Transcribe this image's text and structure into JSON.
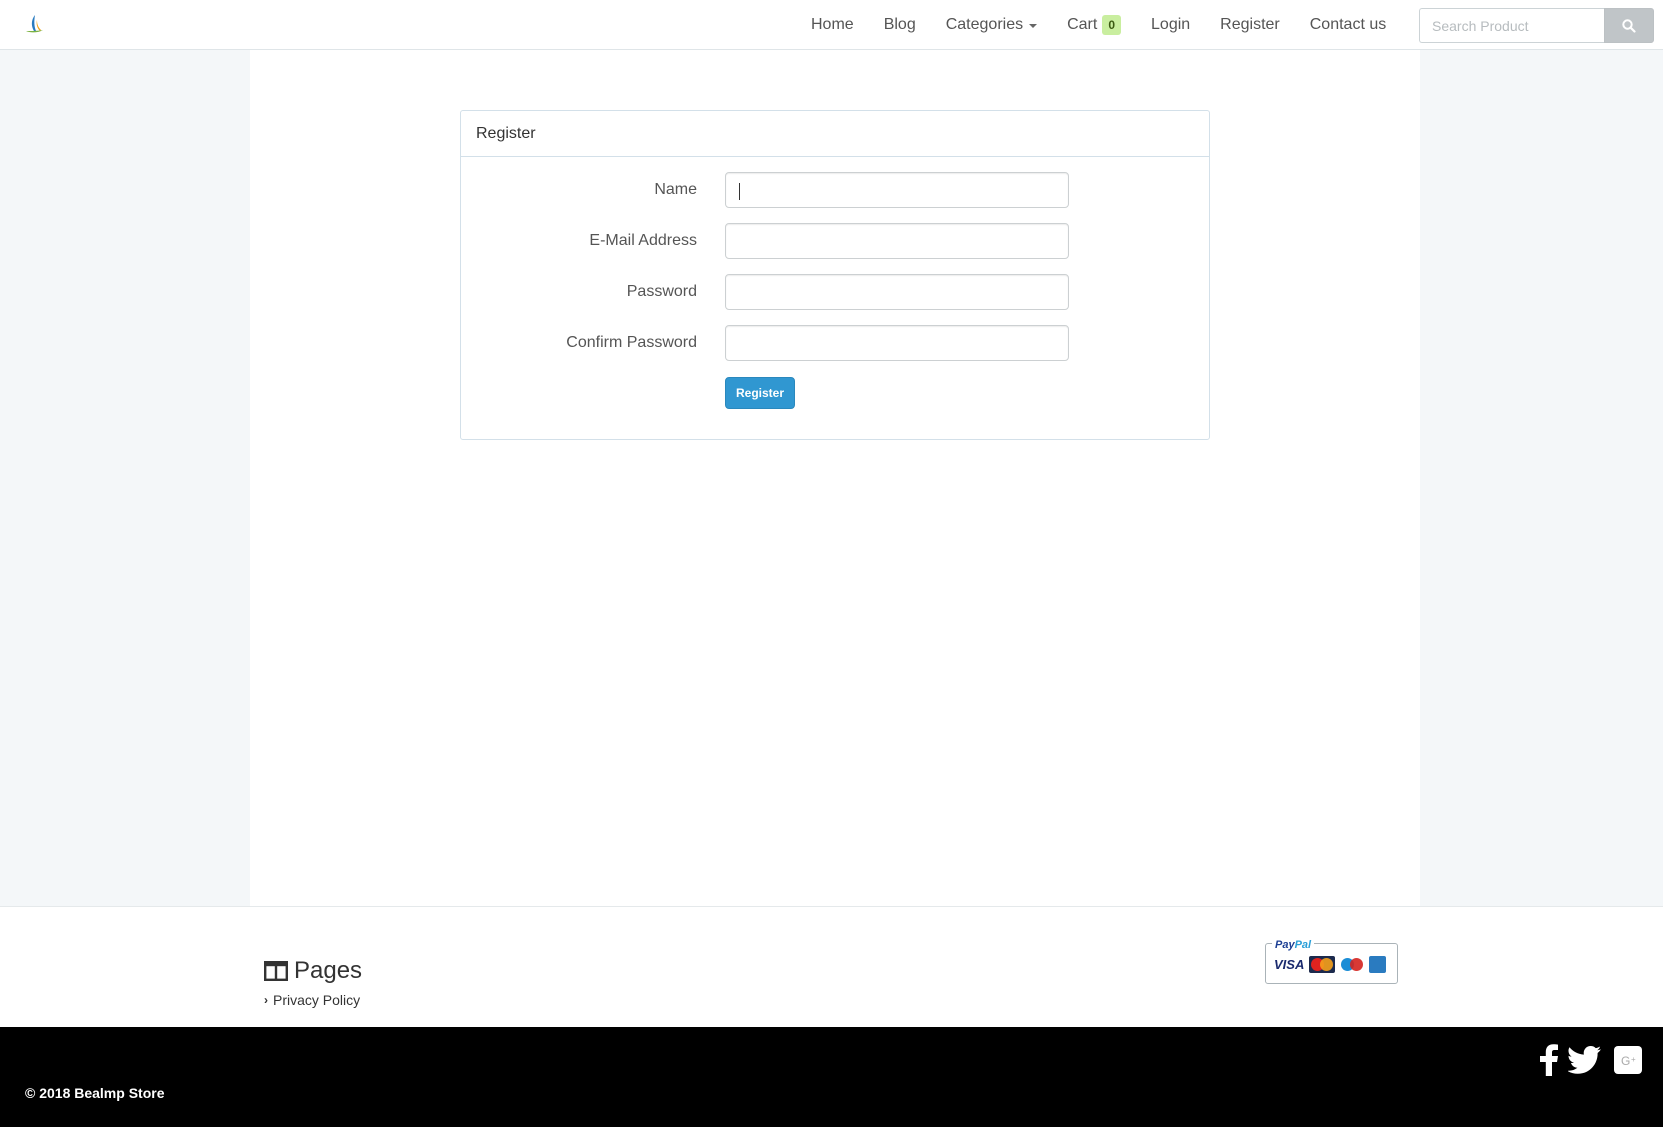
{
  "navbar": {
    "logo_icon": "sail-logo-icon",
    "items": [
      {
        "label": "Home"
      },
      {
        "label": "Blog"
      },
      {
        "label": "Categories"
      },
      {
        "label": "Cart",
        "badge": "0"
      },
      {
        "label": "Login"
      },
      {
        "label": "Register"
      },
      {
        "label": "Contact us"
      }
    ],
    "search": {
      "placeholder": "Search Product",
      "value": "",
      "icon": "search-icon"
    }
  },
  "register_form": {
    "heading": "Register",
    "fields": [
      {
        "label": "Name",
        "value": ""
      },
      {
        "label": "E-Mail Address",
        "value": ""
      },
      {
        "label": "Password",
        "value": ""
      },
      {
        "label": "Confirm Password",
        "value": ""
      }
    ],
    "submit_label": "Register",
    "accent_color": "#3097d1"
  },
  "footer": {
    "pages_title": "Pages",
    "pages_icon": "columns-icon",
    "links": [
      {
        "label": "Privacy Policy"
      }
    ],
    "payment": {
      "paypal_pre": "Pay",
      "paypal_post": "Pal",
      "visa": "VISA"
    }
  },
  "bottom_bar": {
    "copyright": "© 2018 Bealmp Store",
    "social": [
      "facebook-icon",
      "twitter-icon",
      "google-plus-icon"
    ]
  }
}
